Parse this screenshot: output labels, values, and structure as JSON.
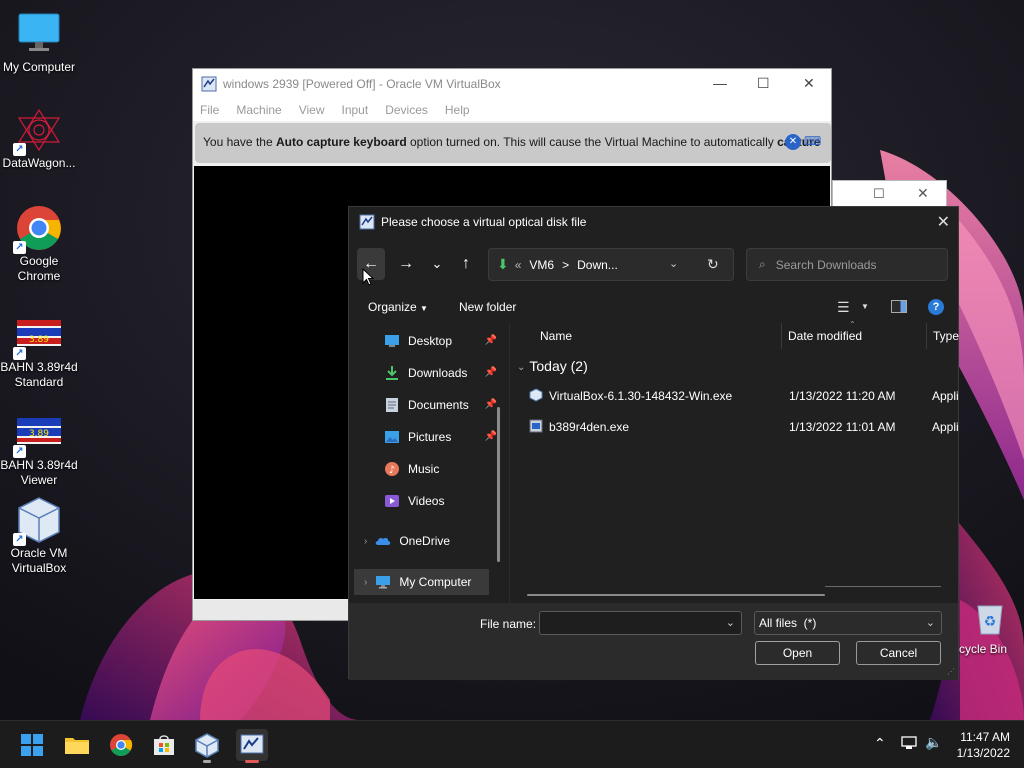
{
  "desktop": {
    "icons": [
      {
        "label": "My Computer",
        "icon": "monitor-icon"
      },
      {
        "label": "DataWagon...",
        "icon": "fractal-icon"
      },
      {
        "label": "Google Chrome",
        "icon": "chrome-icon"
      },
      {
        "label": "BAHN 3.89r4d Standard",
        "icon": "tram-icon"
      },
      {
        "label": "BAHN 3.89r4d Viewer",
        "icon": "tram-icon"
      },
      {
        "label": "Oracle VM VirtualBox",
        "icon": "virtualbox-icon"
      },
      {
        "label": "cycle Bin",
        "icon": "recycle-bin-icon"
      }
    ]
  },
  "vbox_window": {
    "title": "windows 2939 [Powered Off] - Oracle VM VirtualBox",
    "menu": [
      "File",
      "Machine",
      "View",
      "Input",
      "Devices",
      "Help"
    ],
    "notice": {
      "prefix": "You have the ",
      "bold1": "Auto capture keyboard",
      "middle": " option turned on. This will cause the Virtual Machine to automatically ",
      "bold2": "capture"
    },
    "controls": {
      "minimize": "—",
      "maximize": "☐",
      "close": "✕"
    }
  },
  "dialog": {
    "title": "Please choose a virtual optical disk file",
    "nav": {
      "back": "←",
      "forward": "→",
      "recent": "⌄",
      "up": "↑"
    },
    "address": {
      "prefix": "«",
      "parts": [
        "VM6",
        ">",
        "Down..."
      ]
    },
    "search_placeholder": "Search Downloads",
    "toolbar": {
      "organize": "Organize",
      "new_folder": "New folder"
    },
    "sidebar": [
      {
        "label": "Desktop",
        "pinned": true
      },
      {
        "label": "Downloads",
        "pinned": true
      },
      {
        "label": "Documents",
        "pinned": true
      },
      {
        "label": "Pictures",
        "pinned": true
      },
      {
        "label": "Music",
        "pinned": false
      },
      {
        "label": "Videos",
        "pinned": false
      },
      {
        "label": "OneDrive",
        "pinned": false
      },
      {
        "label": "My Computer",
        "pinned": false
      }
    ],
    "columns": {
      "name": "Name",
      "date": "Date modified",
      "type": "Type"
    },
    "group_label": "Today (2)",
    "files": [
      {
        "name": "VirtualBox-6.1.30-148432-Win.exe",
        "date": "1/13/2022 11:20 AM",
        "type": "Appli"
      },
      {
        "name": "b389r4den.exe",
        "date": "1/13/2022 11:01 AM",
        "type": "Appli"
      }
    ],
    "filename_label": "File name:",
    "filename_value": "",
    "filetype": "All files  (*)",
    "open_label": "Open",
    "cancel_label": "Cancel"
  },
  "taskbar": {
    "time": "11:47 AM",
    "date": "1/13/2022"
  },
  "colors": {
    "accent": "#0078d4",
    "dialog_bg": "#202020",
    "taskbar_bg": "#1c1c1c"
  }
}
